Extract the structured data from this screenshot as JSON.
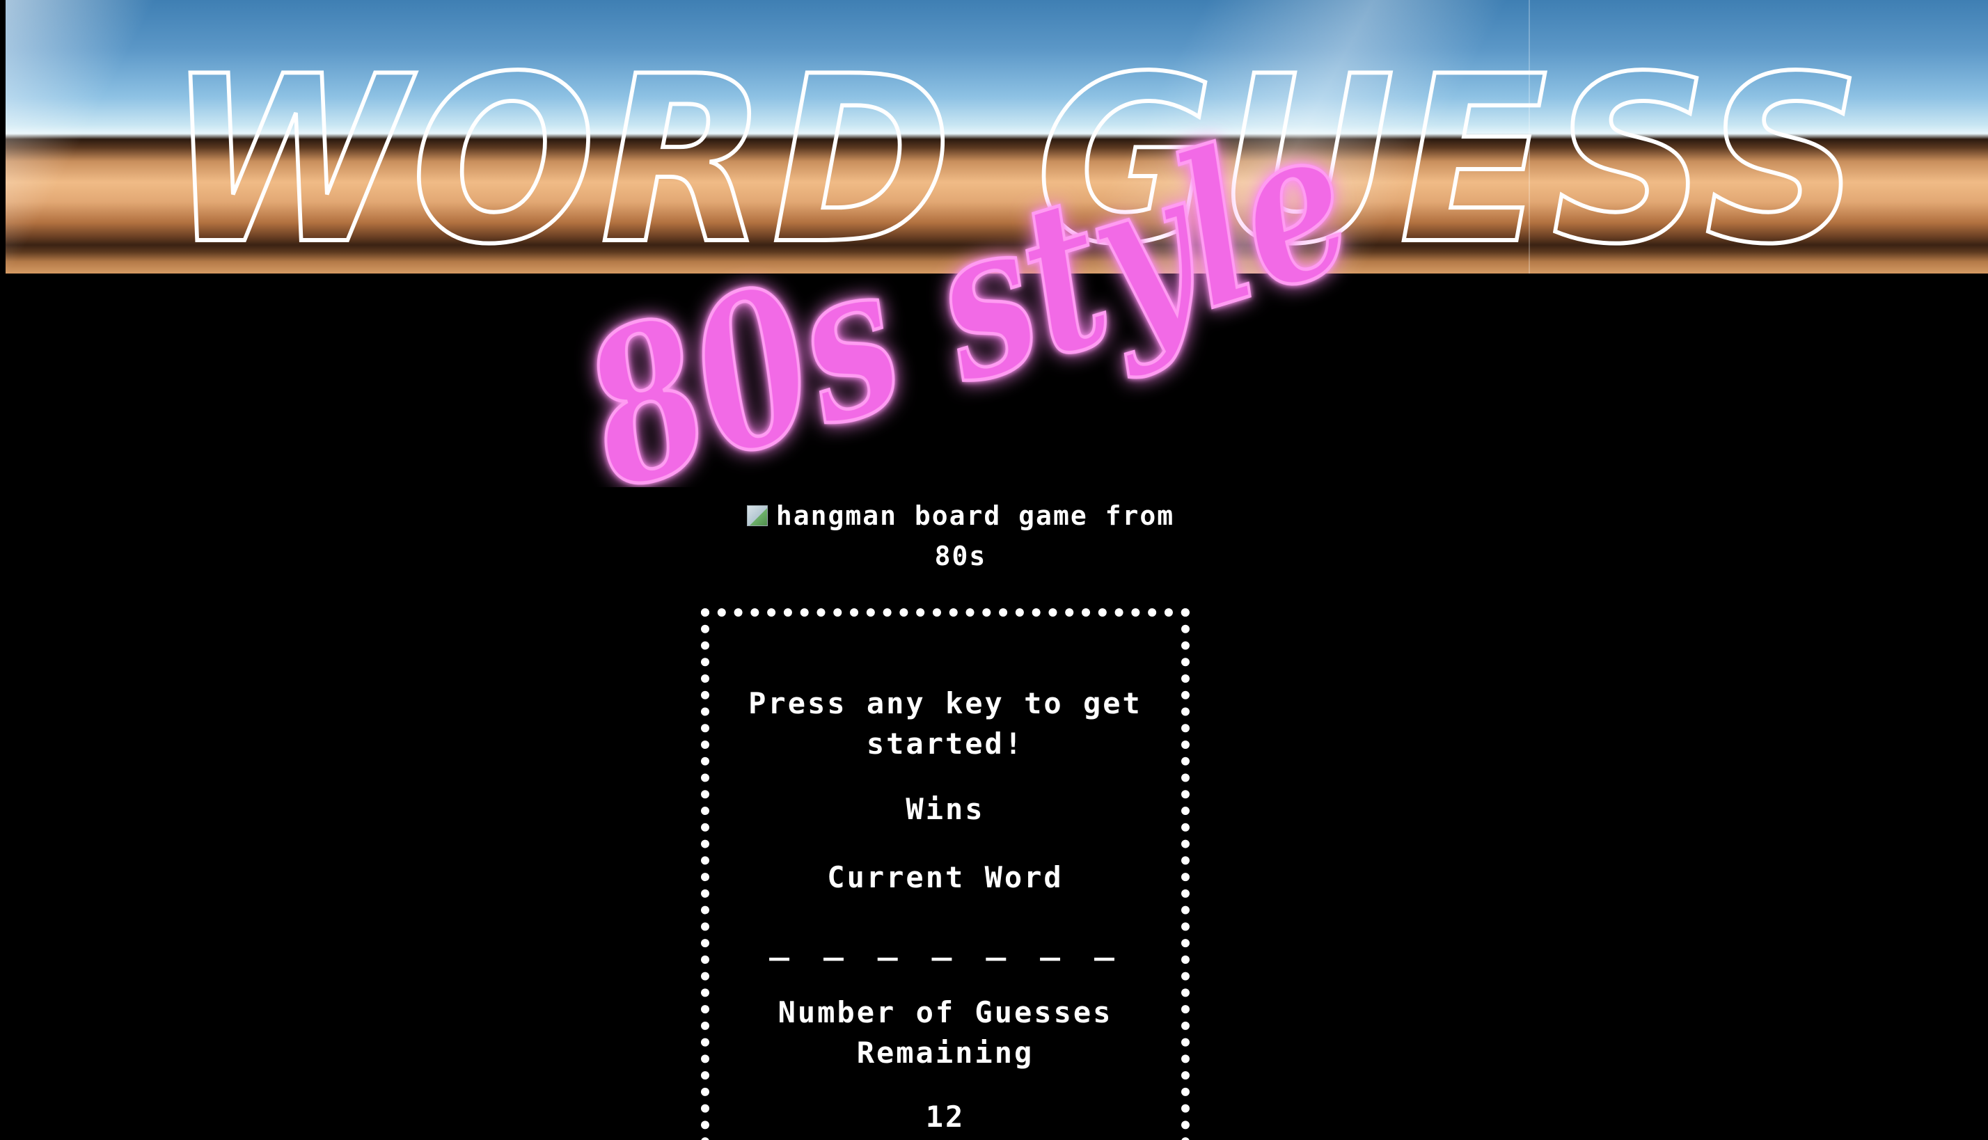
{
  "header": {
    "title": "WORD GUESS",
    "subtitle": "80s style"
  },
  "hero_image": {
    "alt_text": "hangman board game from 80s"
  },
  "game": {
    "prompt": "Press any key to get started!",
    "wins_label": "Wins",
    "current_word_label": "Current Word",
    "current_word_blanks": "_ _ _ _ _ _ _",
    "guesses_remaining_label": "Number of Guesses Remaining",
    "guesses_remaining_value": "12"
  },
  "colors": {
    "background": "#000000",
    "neon_pink": "#f26ae6",
    "text": "#ffffff"
  }
}
